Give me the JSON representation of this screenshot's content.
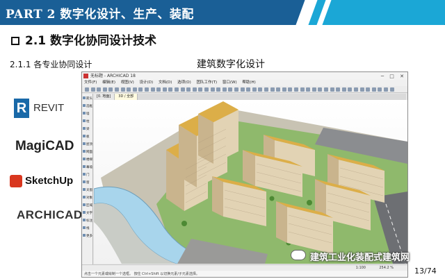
{
  "header": {
    "title_en": "PART 2",
    "title_cn": "数字化设计、生产、装配"
  },
  "section": {
    "title": "2.1 数字化协同设计技术",
    "subtitle": "2.1.1 各专业协同设计",
    "caption": "建筑数字化设计"
  },
  "logos": {
    "revit_mark": "R",
    "revit": "REVIT",
    "magicad": "MagiCAD",
    "sketchup": "SketchUp",
    "archicad": "ARCHICAD"
  },
  "app": {
    "title": "无标题 - ARCHICAD 18",
    "window_controls": "─ □ ✕",
    "menu": [
      "文件(F)",
      "编辑(E)",
      "视图(V)",
      "设计(D)",
      "文档(D)",
      "选项(O)",
      "团队工作(T)",
      "窗口(W)",
      "帮助(H)"
    ],
    "tabs": [
      "[0. 地面]",
      "3D / 全部"
    ],
    "palette": [
      "箭头",
      "选框",
      "墙",
      "柱",
      "梁",
      "板",
      "屋顶",
      "网面",
      "楼梯",
      "幕墙",
      "门",
      "窗",
      "天窗",
      "对象",
      "区域",
      "文字",
      "标注",
      "线",
      "更多"
    ],
    "scale": "1:100",
    "zoom": "254.2 %",
    "hint": "点击一个元素或绘制一个选框。 按住 Ctrl+Shift 以切换元素/子元素选择。"
  },
  "watermark": "建筑工业化装配式建筑网",
  "page": "13/74",
  "colors": {
    "header_blue": "#1a5f96",
    "header_cyan": "#1ba7d6",
    "roof": "#dcae48",
    "facade": "#d9c7a4",
    "river": "#a8d5ec",
    "grass": "#6aa84f",
    "road": "#6d6f73"
  }
}
